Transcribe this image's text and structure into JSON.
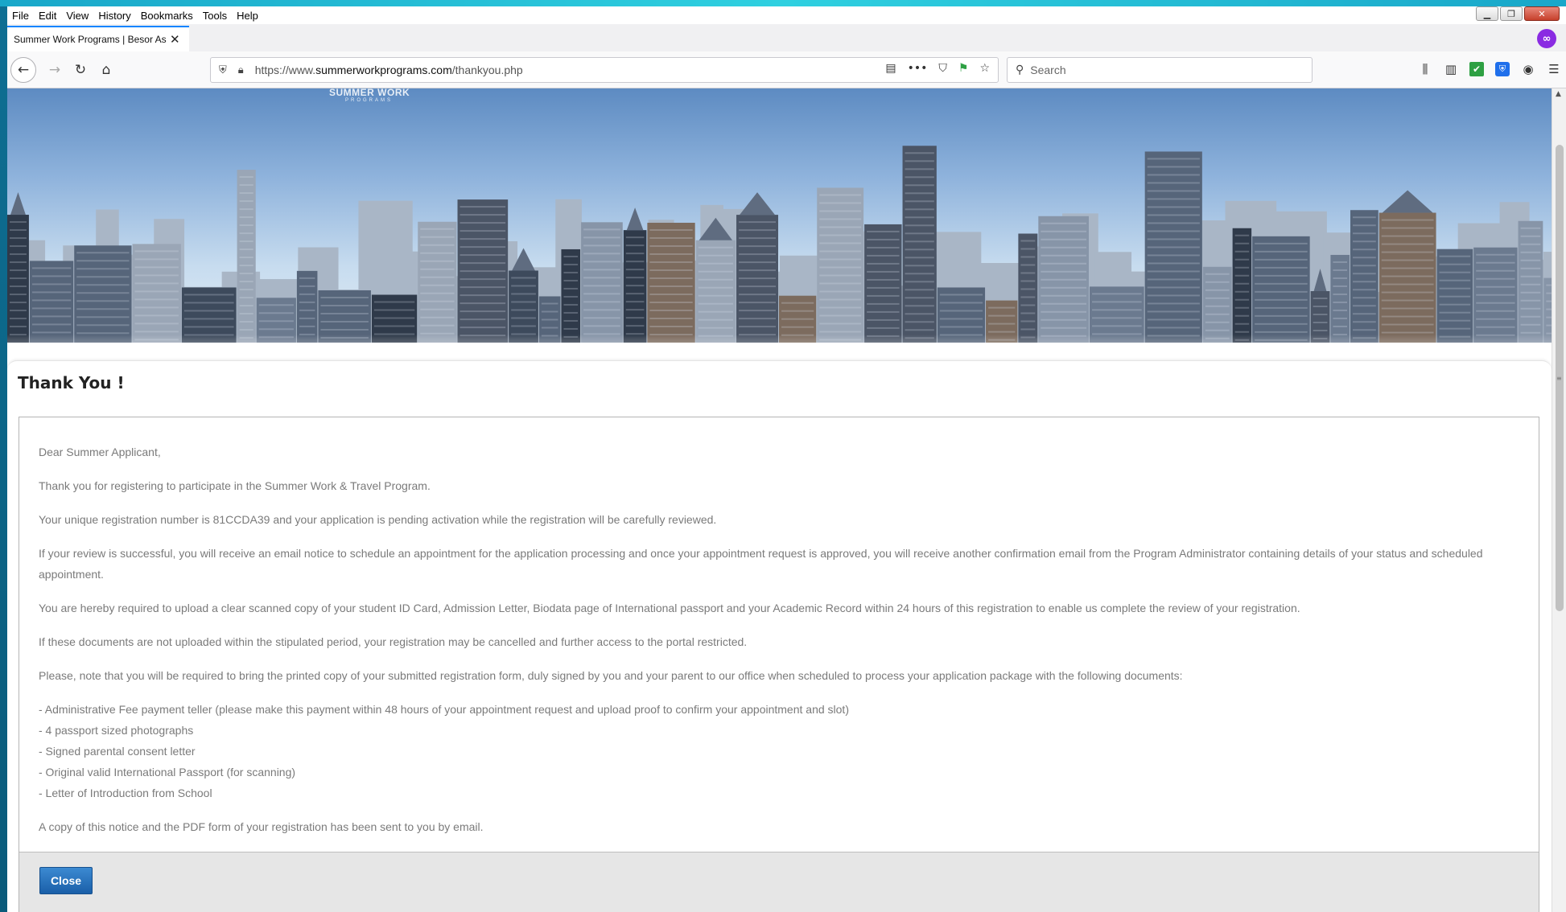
{
  "browser": {
    "menu": [
      "File",
      "Edit",
      "View",
      "History",
      "Bookmarks",
      "Tools",
      "Help"
    ],
    "tab_title": "Summer Work Programs | Besor As",
    "url_prefix": "https://www.",
    "url_domain": "summerworkprograms.com",
    "url_path": "/thankyou.php",
    "search_placeholder": "Search"
  },
  "page": {
    "logo": "SUMMER WORK",
    "logo_sub": "PROGRAMS",
    "title": "Thank You !",
    "paragraphs": [
      "Dear Summer Applicant,",
      "Thank you for registering to participate in the Summer Work & Travel Program.",
      "Your unique registration number is 81CCDA39 and your application is pending activation while the registration will be carefully reviewed.",
      "If your review is successful, you will receive an email notice to schedule an appointment for the application processing and once your appointment request is approved, you will receive another confirmation email from the Program Administrator containing details of your status and scheduled appointment.",
      "You are hereby required to upload a clear scanned copy of your student ID Card, Admission Letter, Biodata page of International passport and your Academic Record within 24 hours of this registration to enable us complete the review of your registration.",
      "If these documents are not uploaded within the stipulated period, your registration may be cancelled and further access to the portal restricted.",
      "Please, note that you will be required to bring the printed copy of your submitted registration form, duly signed by you and your parent to our office when scheduled to process your application package with the following documents:"
    ],
    "documents": [
      "- Administrative Fee payment teller (please make this payment within 48 hours of your appointment request and upload proof to confirm your appointment and slot)",
      "- 4 passport sized photographs",
      "- Signed parental consent letter",
      "- Original valid International Passport (for scanning)",
      "- Letter of Introduction from School"
    ],
    "closing": "A copy of this notice and the PDF form of your registration has been sent to you by email.",
    "close_label": "Close"
  }
}
